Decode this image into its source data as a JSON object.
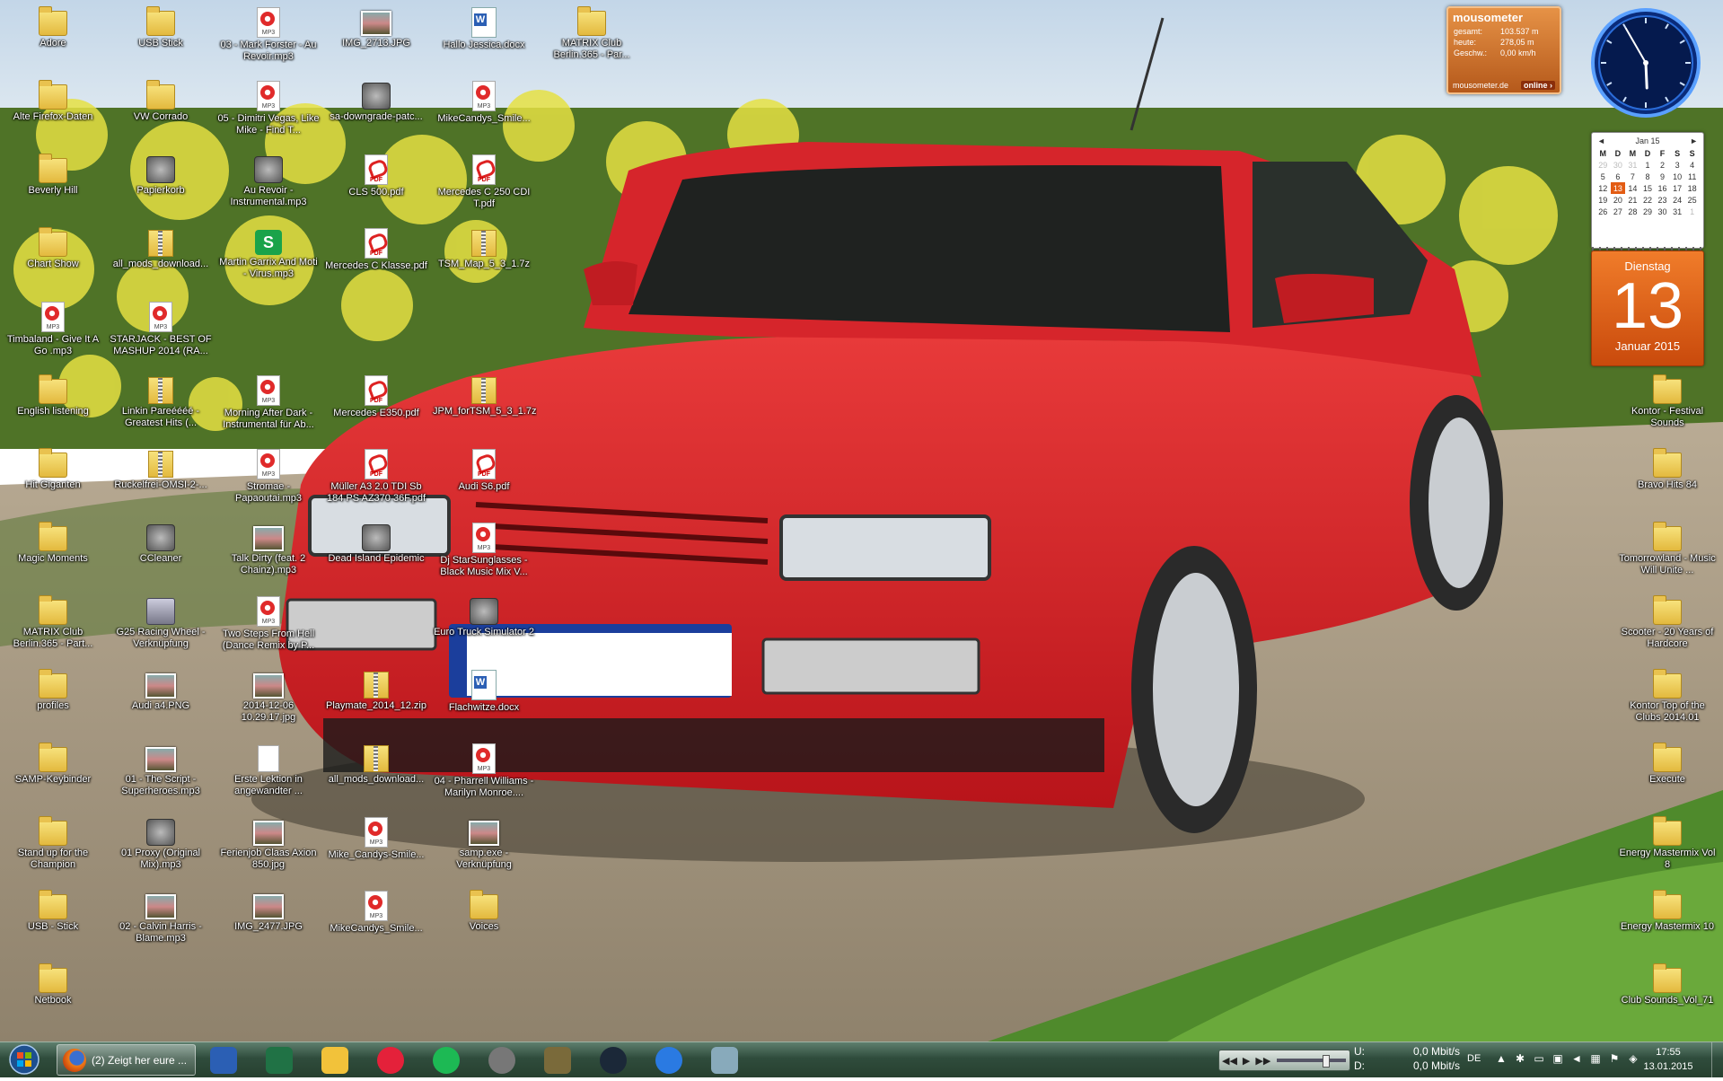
{
  "desktop": {
    "col1": [
      {
        "label": "Adore",
        "type": "folder"
      },
      {
        "label": "Alte Firefox-Daten",
        "type": "folder"
      },
      {
        "label": "Beverly Hill",
        "type": "folder"
      },
      {
        "label": "Chart Show",
        "type": "folder"
      },
      {
        "label": "Timbaland - Give It A Go .mp3",
        "type": "mp3"
      },
      {
        "label": "English listening",
        "type": "folder"
      },
      {
        "label": "Hit Giganten",
        "type": "folder"
      },
      {
        "label": "Magic Moments",
        "type": "folder"
      },
      {
        "label": "MATRIX Club Berlin.365 - Part...",
        "type": "folder"
      },
      {
        "label": "profiles",
        "type": "folder"
      },
      {
        "label": "SAMP-Keybinder",
        "type": "folder"
      },
      {
        "label": "Stand up for the Champion",
        "type": "folder"
      },
      {
        "label": "USB - Stick",
        "type": "folder"
      },
      {
        "label": "Netbook",
        "type": "folder"
      }
    ],
    "col2": [
      {
        "label": "USB Stick",
        "type": "folder"
      },
      {
        "label": "VW Corrado",
        "type": "folder"
      },
      {
        "label": "Papierkorb",
        "type": "app"
      },
      {
        "label": "all_mods_download...",
        "type": "zip"
      },
      {
        "label": "STARJACK - BEST OF MASHUP 2014 (RA...",
        "type": "mp3"
      },
      {
        "label": "Linkin Pareéééé - Greatest Hits (...",
        "type": "zip"
      },
      {
        "label": "Ruckelfrei-OMSI-2-...",
        "type": "zip"
      },
      {
        "label": "CCleaner",
        "type": "app"
      },
      {
        "label": "G25 Racing Wheel - Verknüpfung",
        "type": "lnk"
      },
      {
        "label": "Audi a4.PNG",
        "type": "img"
      },
      {
        "label": "01 - The Script - Superheroes.mp3",
        "type": "img"
      },
      {
        "label": "01 Proxy (Original Mix).mp3",
        "type": "app"
      },
      {
        "label": "02 - Calvin Harris - Blame.mp3",
        "type": "img"
      }
    ],
    "col3": [
      {
        "label": "03 - Mark Forster - Au Revoir.mp3",
        "type": "mp3"
      },
      {
        "label": "05 - Dimitri Vegas, Like Mike - Find T...",
        "type": "mp3"
      },
      {
        "label": "Au Revoir - Instrumental.mp3",
        "type": "app"
      },
      {
        "label": "Martin Garrix And Moti - Virus.mp3",
        "type": "green"
      },
      {
        "label": "",
        "type": "none"
      },
      {
        "label": "Morning After Dark - Instrumental für Ab...",
        "type": "mp3"
      },
      {
        "label": "Stromae - Papaoutai.mp3",
        "type": "mp3"
      },
      {
        "label": "Talk Dirty (feat. 2 Chainz).mp3",
        "type": "img"
      },
      {
        "label": "Two Steps From Hell (Dance Remix by P...",
        "type": "mp3"
      },
      {
        "label": "2014-12-06 10.29.17.jpg",
        "type": "img"
      },
      {
        "label": "Erste Lektion in angewandter ...",
        "type": "white"
      },
      {
        "label": "Ferienjob Claas Axion 850.jpg",
        "type": "img"
      },
      {
        "label": "IMG_2477.JPG",
        "type": "img"
      }
    ],
    "col4": [
      {
        "label": "IMG_2713.JPG",
        "type": "img"
      },
      {
        "label": "sa-downgrade-patc...",
        "type": "app"
      },
      {
        "label": "CLS 500.pdf",
        "type": "pdf"
      },
      {
        "label": "Mercedes C Klasse.pdf",
        "type": "pdf"
      },
      {
        "label": "",
        "type": "none"
      },
      {
        "label": "Mercedes E350.pdf",
        "type": "pdf"
      },
      {
        "label": "Müller A3 2.0 TDI Sb 184 PS AZ370 36F.pdf",
        "type": "pdf"
      },
      {
        "label": "Dead Island Epidemic",
        "type": "app"
      },
      {
        "label": "",
        "type": "none"
      },
      {
        "label": "Playmate_2014_12.zip",
        "type": "zip"
      },
      {
        "label": "all_mods_download...",
        "type": "zip"
      },
      {
        "label": "Mike_Candys-Smile...",
        "type": "mp3"
      },
      {
        "label": "MikeCandys_Smile...",
        "type": "mp3"
      }
    ],
    "col5": [
      {
        "label": "Hallo Jessica.docx",
        "type": "doc"
      },
      {
        "label": "MikeCandys_Smile...",
        "type": "mp3"
      },
      {
        "label": "Mercedes C 250 CDI T.pdf",
        "type": "pdf"
      },
      {
        "label": "TSM_Map_5_3_1.7z",
        "type": "zip"
      },
      {
        "label": "",
        "type": "none"
      },
      {
        "label": "JPM_forTSM_5_3_1.7z",
        "type": "zip"
      },
      {
        "label": "Audi S6.pdf",
        "type": "pdf"
      },
      {
        "label": "Dj StarSunglasses - Black Music Mix V...",
        "type": "mp3"
      },
      {
        "label": "Euro Truck Simulator 2",
        "type": "app"
      },
      {
        "label": "Flachwitze.docx",
        "type": "doc"
      },
      {
        "label": "04 - Pharrell Williams - Marilyn Monroe....",
        "type": "mp3"
      },
      {
        "label": "samp.exe - Verknüpfung",
        "type": "img"
      },
      {
        "label": "Voices",
        "type": "folder"
      }
    ],
    "col6": [
      {
        "label": "MATRIX Club Berlin.365 - Par...",
        "type": "folder"
      }
    ],
    "right": [
      {
        "label": "Kontor - Festival Sounds",
        "type": "folder"
      },
      {
        "label": "Bravo Hits 84",
        "type": "folder"
      },
      {
        "label": "Tomorrowland - Music Will Unite ...",
        "type": "folder"
      },
      {
        "label": "Scooter - 20 Years of Hardcore",
        "type": "folder"
      },
      {
        "label": "Kontor Top of the Clubs 2014.01",
        "type": "folder"
      },
      {
        "label": "Execute",
        "type": "folder"
      },
      {
        "label": "Energy Mastermix Vol 8",
        "type": "folder"
      },
      {
        "label": "Energy Mastermix 10",
        "type": "folder"
      },
      {
        "label": "Club Sounds_Vol_71",
        "type": "folder"
      }
    ]
  },
  "widgets": {
    "mousometer": {
      "title": "mousometer",
      "rows": [
        {
          "k": "gesamt:",
          "v": "103.537 m"
        },
        {
          "k": "heute:",
          "v": "278,05 m"
        },
        {
          "k": "Geschw.:",
          "v": "0,00 km/h"
        }
      ],
      "site": "mousometer.de",
      "status": "online ›"
    },
    "calendar": {
      "month": "Jan 15",
      "prev": "◄",
      "next": "►",
      "weekdays": [
        "M",
        "D",
        "M",
        "D",
        "F",
        "S",
        "S"
      ],
      "weeks": [
        [
          "29",
          "30",
          "31",
          "1",
          "2",
          "3",
          "4"
        ],
        [
          "5",
          "6",
          "7",
          "8",
          "9",
          "10",
          "11"
        ],
        [
          "12",
          "13",
          "14",
          "15",
          "16",
          "17",
          "18"
        ],
        [
          "19",
          "20",
          "21",
          "22",
          "23",
          "24",
          "25"
        ],
        [
          "26",
          "27",
          "28",
          "29",
          "30",
          "31",
          "1"
        ]
      ],
      "today": "13"
    },
    "datecard": {
      "weekday": "Dienstag",
      "day": "13",
      "month_year": "Januar 2015"
    },
    "clock": {
      "hour": 17,
      "minute": 55
    }
  },
  "taskbar": {
    "firefox_title": "(2) Zeigt her eure ...",
    "pinned": [
      "word-icon",
      "excel-icon",
      "mail-icon",
      "itunes-icon",
      "spotify-icon",
      "audio-icon",
      "game-icon",
      "steam-icon",
      "app-icon",
      "network-icon"
    ],
    "media": {
      "prev": "◀◀",
      "play": "▶",
      "next": "▶▶"
    },
    "net_upload_label": "U:",
    "net_download_label": "D:",
    "net_upload": "0,0 Mbit/s",
    "net_download": "0,0 Mbit/s",
    "lang": "DE",
    "time": "17:55",
    "date": "13.01.2015"
  }
}
